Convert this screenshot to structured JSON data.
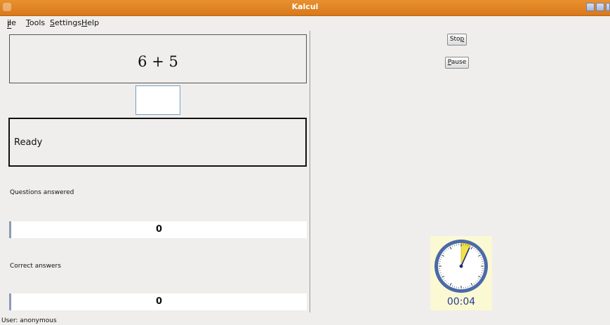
{
  "window": {
    "title": "Kalcul"
  },
  "menu": {
    "file": {
      "first": "F",
      "rest": "ile"
    },
    "tools": {
      "first": "T",
      "rest": "ools"
    },
    "settings": {
      "first": "S",
      "rest": "ettings"
    },
    "help": {
      "first": "H",
      "rest": "elp"
    }
  },
  "question": {
    "text": "6 + 5"
  },
  "answer": {
    "value": ""
  },
  "status": {
    "text": "Ready"
  },
  "stats": {
    "questions_label": "Questions answered",
    "questions_value": "0",
    "correct_label": "Correct answers",
    "correct_value": "0"
  },
  "controls": {
    "stop": {
      "before": "Sto",
      "mnemonic": "p",
      "after": ""
    },
    "pause": {
      "before": "",
      "mnemonic": "P",
      "after": "ause"
    }
  },
  "timer": {
    "time": "00:04",
    "elapsed_fraction": 0.067,
    "colors": {
      "face": "#ffffff",
      "rim": "#4a6aa8",
      "wedge": "#f2e24a",
      "text": "#2a3a8f"
    }
  },
  "user": {
    "label": "User: anonymous"
  }
}
